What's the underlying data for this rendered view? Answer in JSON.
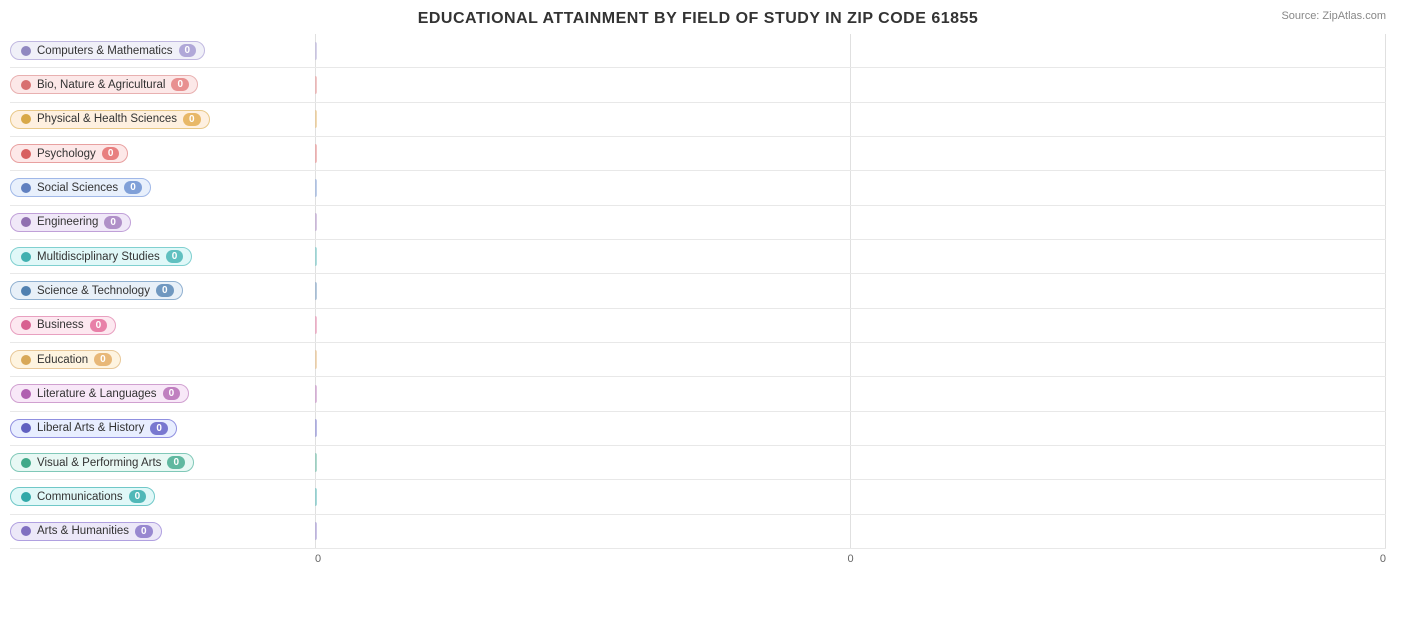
{
  "title": "EDUCATIONAL ATTAINMENT BY FIELD OF STUDY IN ZIP CODE 61855",
  "source": "Source: ZipAtlas.com",
  "xAxisLabels": [
    "0",
    "0",
    "0"
  ],
  "bars": [
    {
      "label": "Computers & Mathematics",
      "value": 0,
      "pillBg": "#f0f0f8",
      "pillBorder": "#c0b8e0",
      "badgeBg": "#b0a8d8",
      "dotColor": "#9088c0"
    },
    {
      "label": "Bio, Nature & Agricultural",
      "value": 0,
      "pillBg": "#fce8e8",
      "pillBorder": "#e8b0b0",
      "badgeBg": "#e89090",
      "dotColor": "#d87070"
    },
    {
      "label": "Physical & Health Sciences",
      "value": 0,
      "pillBg": "#fef0e0",
      "pillBorder": "#e8c888",
      "badgeBg": "#e8b868",
      "dotColor": "#d8a848"
    },
    {
      "label": "Psychology",
      "value": 0,
      "pillBg": "#fde8e8",
      "pillBorder": "#e8a0a0",
      "badgeBg": "#e88080",
      "dotColor": "#d86060"
    },
    {
      "label": "Social Sciences",
      "value": 0,
      "pillBg": "#e8f0fc",
      "pillBorder": "#a0b8e8",
      "badgeBg": "#80a0d8",
      "dotColor": "#6080c0"
    },
    {
      "label": "Engineering",
      "value": 0,
      "pillBg": "#f0e8f8",
      "pillBorder": "#c0a0d8",
      "badgeBg": "#b090c8",
      "dotColor": "#9070b0"
    },
    {
      "label": "Multidisciplinary Studies",
      "value": 0,
      "pillBg": "#e0f8f8",
      "pillBorder": "#80d0d0",
      "badgeBg": "#60c0c0",
      "dotColor": "#40b0b0"
    },
    {
      "label": "Science & Technology",
      "value": 0,
      "pillBg": "#e8f0f8",
      "pillBorder": "#90b0d0",
      "badgeBg": "#7098c0",
      "dotColor": "#5080b0"
    },
    {
      "label": "Business",
      "value": 0,
      "pillBg": "#fde8f0",
      "pillBorder": "#e8a0c0",
      "badgeBg": "#e880a8",
      "dotColor": "#d86090"
    },
    {
      "label": "Education",
      "value": 0,
      "pillBg": "#fef4e0",
      "pillBorder": "#e8c898",
      "badgeBg": "#e8b878",
      "dotColor": "#d8a858"
    },
    {
      "label": "Literature & Languages",
      "value": 0,
      "pillBg": "#f8e8f8",
      "pillBorder": "#d0a0d0",
      "badgeBg": "#c080c0",
      "dotColor": "#b060b0"
    },
    {
      "label": "Liberal Arts & History",
      "value": 0,
      "pillBg": "#e8eeff",
      "pillBorder": "#9090e0",
      "badgeBg": "#7878d0",
      "dotColor": "#6060c0"
    },
    {
      "label": "Visual & Performing Arts",
      "value": 0,
      "pillBg": "#e8f8f4",
      "pillBorder": "#80c8b8",
      "badgeBg": "#60b8a0",
      "dotColor": "#40a888"
    },
    {
      "label": "Communications",
      "value": 0,
      "pillBg": "#e0f8f8",
      "pillBorder": "#70c8c8",
      "badgeBg": "#50b8b8",
      "dotColor": "#30a8a8"
    },
    {
      "label": "Arts & Humanities",
      "value": 0,
      "pillBg": "#ece8f8",
      "pillBorder": "#b0a0e0",
      "badgeBg": "#9888d0",
      "dotColor": "#8070c0"
    }
  ]
}
